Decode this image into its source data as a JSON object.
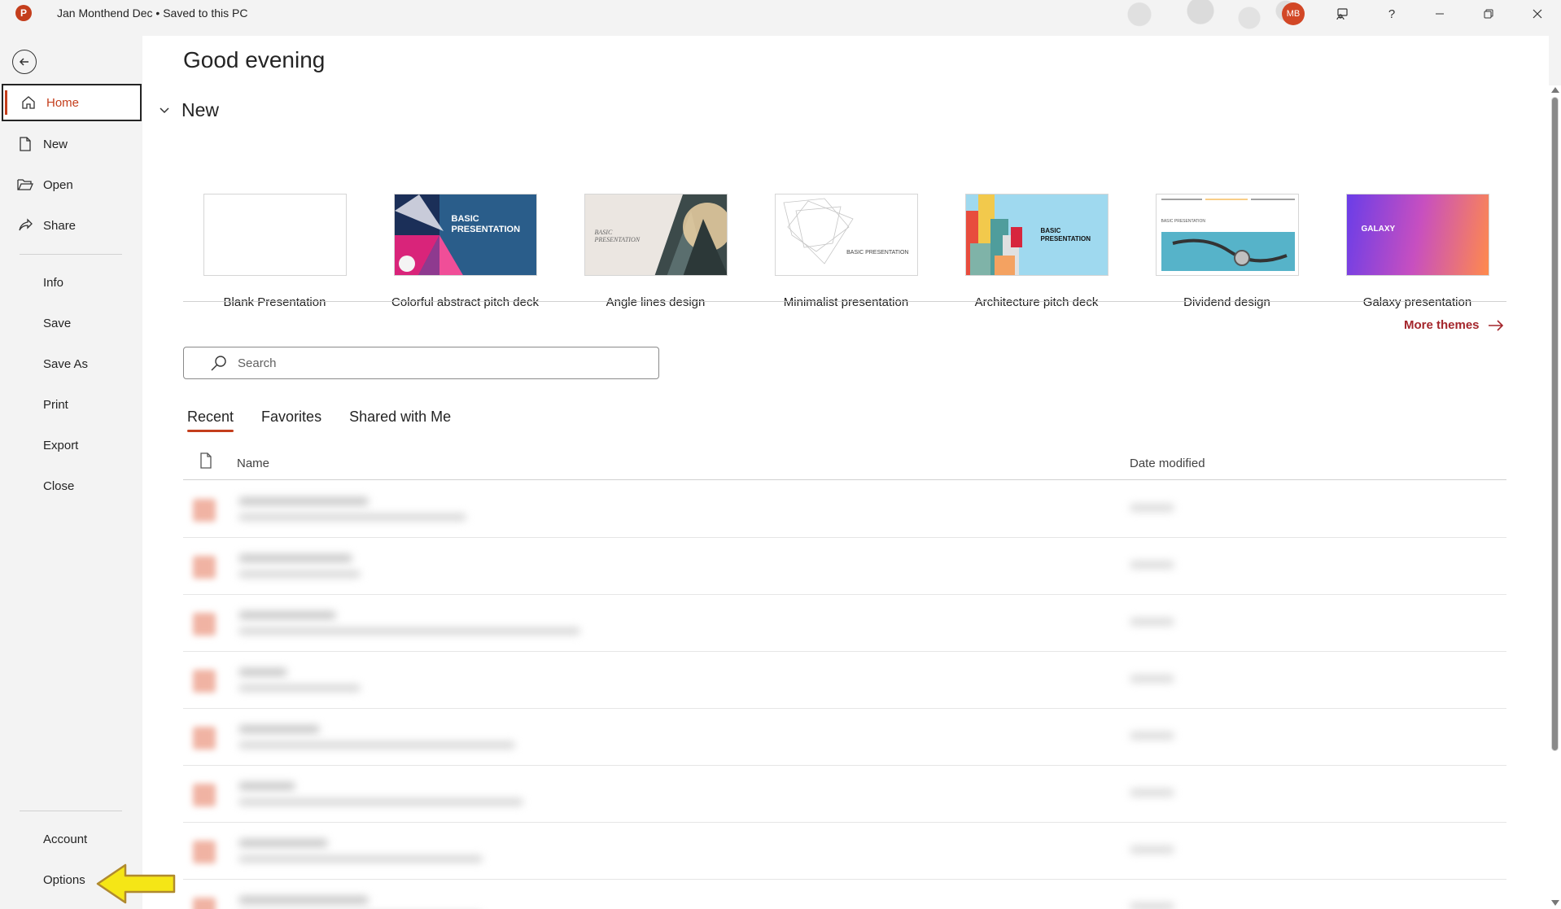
{
  "titlebar": {
    "app_icon": "P",
    "doc_title": "Jan Monthend Dec • Saved to this PC",
    "avatar_initials": "MB",
    "icons": [
      "feedback-icon",
      "help-icon",
      "minimize-icon",
      "restore-icon",
      "close-icon"
    ],
    "help_glyph": "?"
  },
  "sidebar": {
    "items": [
      {
        "label": "Home",
        "icon": "home-icon"
      },
      {
        "label": "New",
        "icon": "new-document-icon"
      },
      {
        "label": "Open",
        "icon": "folder-open-icon"
      },
      {
        "label": "Share",
        "icon": "share-icon"
      },
      {
        "label": "Info"
      },
      {
        "label": "Save"
      },
      {
        "label": "Save As"
      },
      {
        "label": "Print"
      },
      {
        "label": "Export"
      },
      {
        "label": "Close"
      },
      {
        "label": "Account"
      },
      {
        "label": "Options"
      }
    ]
  },
  "main": {
    "greeting": "Good evening",
    "new_section": "New",
    "templates": [
      {
        "name": "Blank Presentation"
      },
      {
        "name": "Colorful abstract pitch deck",
        "thumb_text": "BASIC PRESENTATION"
      },
      {
        "name": "Angle lines design",
        "thumb_text": "BASIC PRESENTATION"
      },
      {
        "name": "Minimalist presentation",
        "thumb_text": "BASIC PRESENTATION"
      },
      {
        "name": "Architecture pitch deck",
        "thumb_text": "BASIC PRESENTATION"
      },
      {
        "name": "Dividend design",
        "thumb_text": "BASIC PRESENTATION"
      },
      {
        "name": "Galaxy presentation",
        "thumb_text": "GALAXY"
      }
    ],
    "more_themes": "More themes",
    "search_placeholder": "Search",
    "tabs": [
      "Recent",
      "Favorites",
      "Shared with Me"
    ],
    "columns": {
      "name": "Name",
      "date": "Date modified"
    }
  },
  "colors": {
    "accent": "#c43e1c",
    "link": "#a4262c",
    "avatar": "#d24726",
    "annotation_arrow": "#f5e616"
  }
}
